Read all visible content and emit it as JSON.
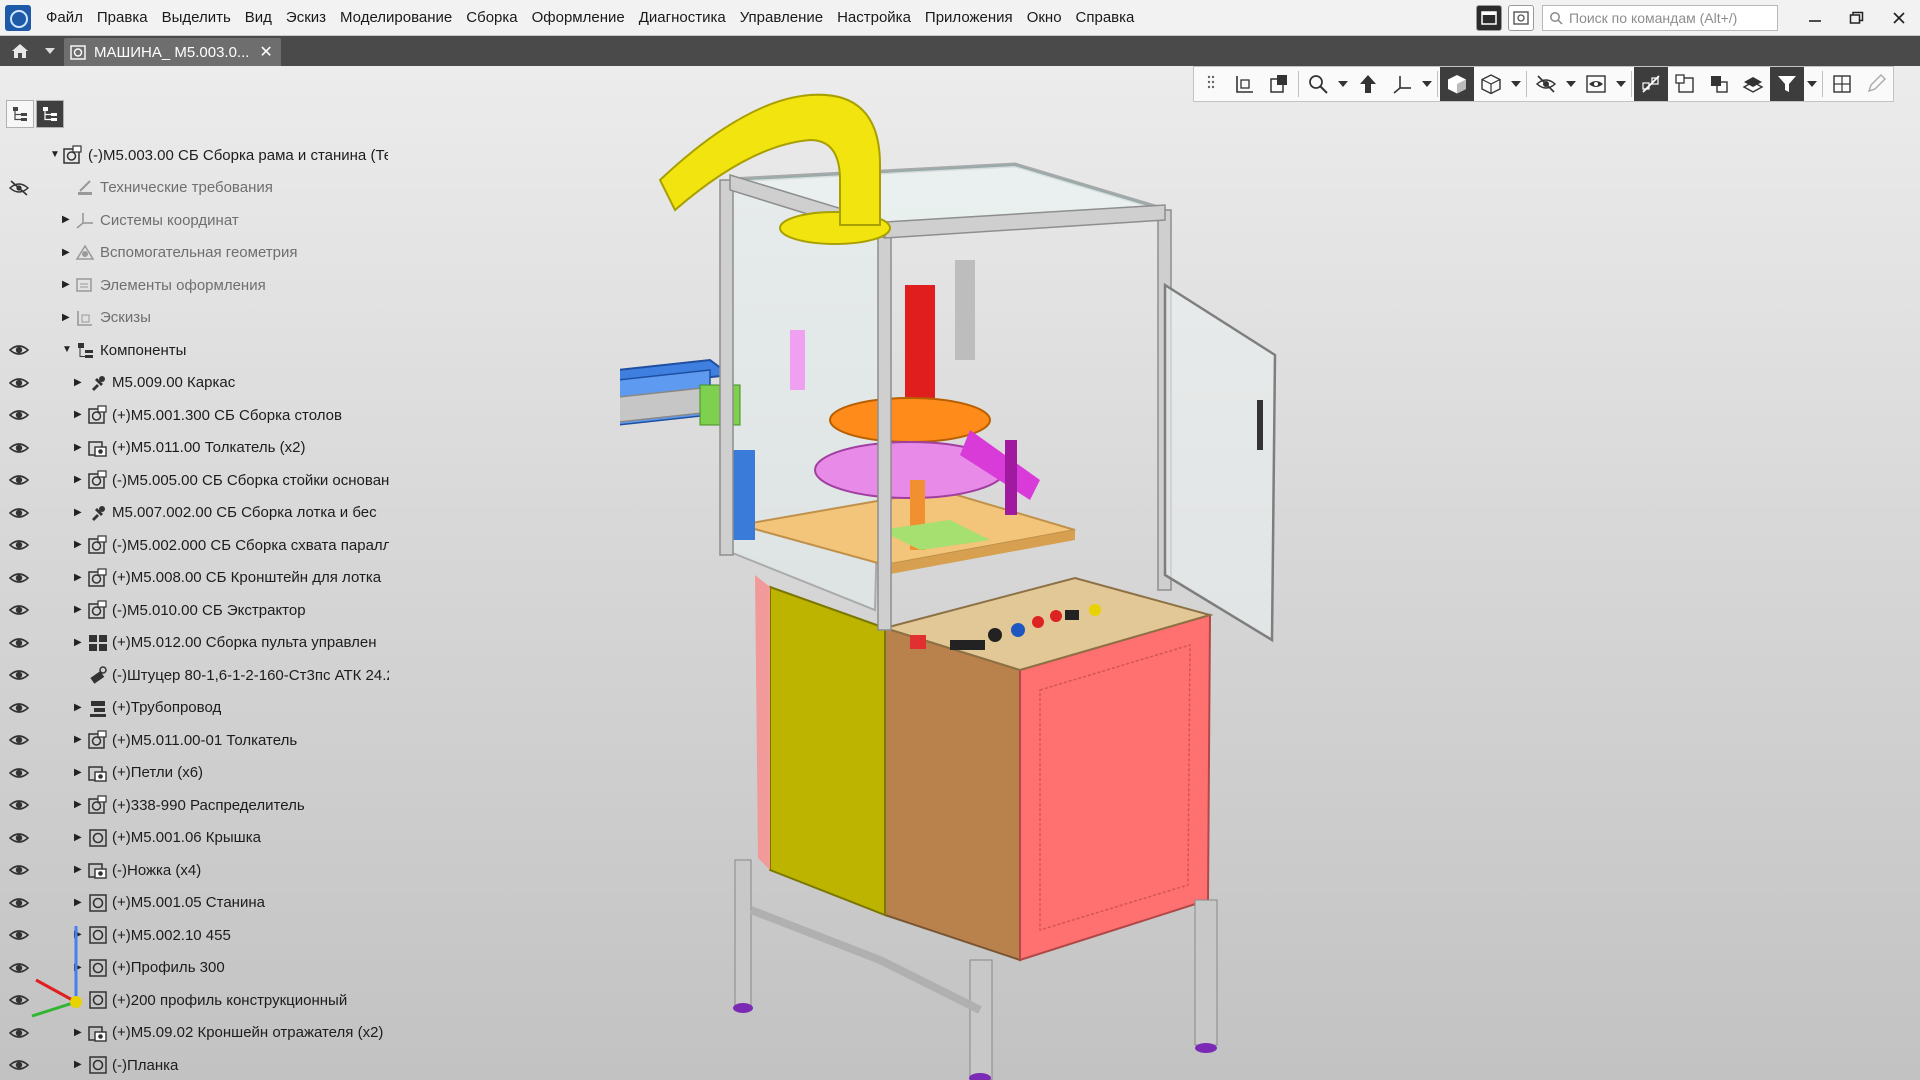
{
  "menu": {
    "items": [
      "Файл",
      "Правка",
      "Выделить",
      "Вид",
      "Эскиз",
      "Моделирование",
      "Сборка",
      "Оформление",
      "Диагностика",
      "Управление",
      "Настройка",
      "Приложения",
      "Окно",
      "Справка"
    ],
    "search_placeholder": "Поиск по командам (Alt+/)"
  },
  "tab": {
    "title": "МАШИНА_ М5.003.0...",
    "close": "✕"
  },
  "tree": {
    "root": "(-)М5.003.00 СБ Сборка рама и станина  (Те",
    "rows": [
      {
        "label": "Технические требования",
        "dim": true
      },
      {
        "label": "Системы координат",
        "dim": true
      },
      {
        "label": "Вспомогательная геометрия",
        "dim": true
      },
      {
        "label": "Элементы оформления",
        "dim": true
      },
      {
        "label": "Эскизы",
        "dim": true
      },
      {
        "label": "Компоненты",
        "dim": false
      },
      {
        "label": "М5.009.00 Каркас"
      },
      {
        "label": "(+)М5.001.300 СБ  Сборка столов"
      },
      {
        "label": "(+)М5.011.00 Толкатель (x2)"
      },
      {
        "label": "(-)М5.005.00 СБ  Сборка стойки основан"
      },
      {
        "label": "М5.007.002.00 СБ  Сборка лотка и бес"
      },
      {
        "label": "(-)М5.002.000 СБ  Сборка схвата паралл"
      },
      {
        "label": "(+)М5.008.00 СБ  Кронштейн для лотка"
      },
      {
        "label": "(-)М5.010.00 СБ  Экстрактор"
      },
      {
        "label": "(+)М5.012.00 Сборка пульта управлен"
      },
      {
        "label": "(-)Штуцер 80-1,6-1-2-160-Ст3пс АТК 24.2"
      },
      {
        "label": "(+)Трубопровод"
      },
      {
        "label": "(+)М5.011.00-01 Толкатель"
      },
      {
        "label": "(+)Петли (x6)"
      },
      {
        "label": "(+)338-990  Распределитель"
      },
      {
        "label": "(+)М5.001.06 Крышка"
      },
      {
        "label": "(-)Ножка (x4)"
      },
      {
        "label": "(+)М5.001.05 Станина"
      },
      {
        "label": "(+)М5.002.10 455"
      },
      {
        "label": "(+)Профиль 300"
      },
      {
        "label": "(+)200 профиль конструкционный"
      },
      {
        "label": "(+)М5.09.02 Кроншейн отражателя (x2)"
      },
      {
        "label": "(-)Планка"
      }
    ]
  },
  "colors": {
    "pipe": "#f2e40e",
    "cabinet_front": "#ff7070",
    "cabinet_side": "#b9814c",
    "yellow_panel": "#bdb400",
    "turntable": "#ff8c1a",
    "frame": "#c9c9c9",
    "magenta": "#d93bd9",
    "blue_tray": "#3f7fe0",
    "feet": "#7a2ab5"
  },
  "icons": {
    "eye": "eye-icon",
    "hidden": "eye-crossed-icon",
    "search": "search-icon",
    "home": "home-icon"
  }
}
